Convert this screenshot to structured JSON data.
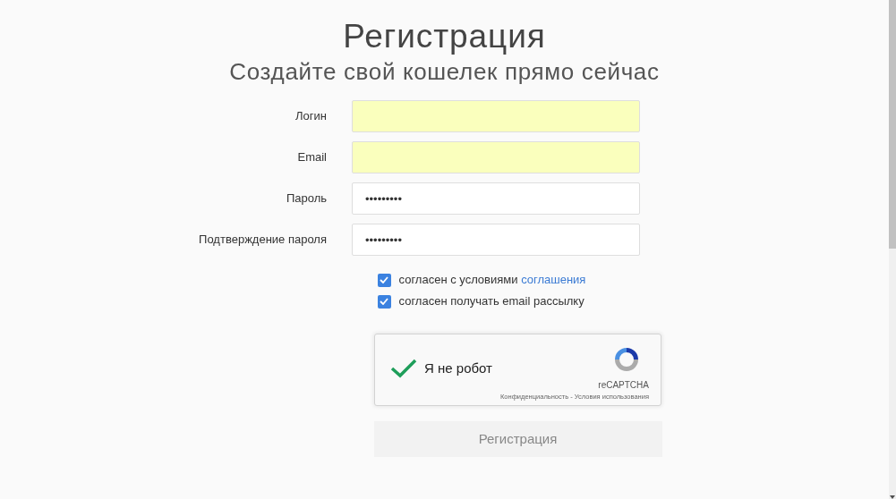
{
  "heading": {
    "title": "Регистрация",
    "subtitle": "Создайте свой кошелек прямо сейчас"
  },
  "fields": [
    {
      "label": "Логин",
      "autofilled": true
    },
    {
      "label": "Email",
      "autofilled": true
    },
    {
      "label": "Пароль",
      "value": "•••••••••",
      "autofilled": false
    },
    {
      "label": "Подтверждение пароля",
      "value": "•••••••••",
      "autofilled": false
    }
  ],
  "checkboxes": [
    {
      "text": "согласен с условиями ",
      "link": "соглашения",
      "checked": true
    },
    {
      "text": "согласен получать email рассылку",
      "checked": true
    }
  ],
  "captcha": {
    "label": "Я не робот",
    "checked": true,
    "brand": "reCAPTCHA",
    "privacy": "Конфиденциальность",
    "separator": " - ",
    "terms": "Условия использования"
  },
  "submit": {
    "label": "Регистрация",
    "disabled": true
  }
}
